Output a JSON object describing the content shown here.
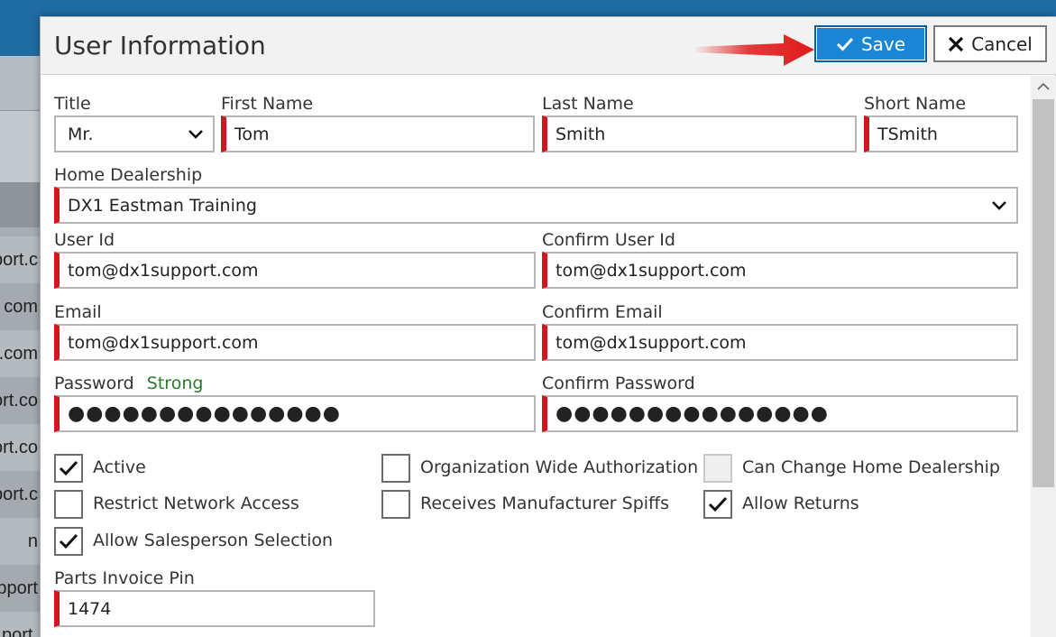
{
  "background": {
    "rows": [
      "port.c",
      "com",
      "rt.com",
      "ort.co",
      "ort.co",
      "port.c",
      "n",
      "pport",
      "port."
    ]
  },
  "dialog": {
    "title": "User Information",
    "save_label": "Save",
    "cancel_label": "Cancel"
  },
  "form": {
    "title_label": "Title",
    "title_value": "Mr.",
    "first_name_label": "First Name",
    "first_name_value": "Tom",
    "last_name_label": "Last Name",
    "last_name_value": "Smith",
    "short_name_label": "Short Name",
    "short_name_value": "TSmith",
    "home_dealership_label": "Home Dealership",
    "home_dealership_value": "DX1 Eastman Training",
    "user_id_label": "User Id",
    "user_id_value": "tom@dx1support.com",
    "confirm_user_id_label": "Confirm User Id",
    "confirm_user_id_value": "tom@dx1support.com",
    "email_label": "Email",
    "email_value": "tom@dx1support.com",
    "confirm_email_label": "Confirm Email",
    "confirm_email_value": "tom@dx1support.com",
    "password_label": "Password",
    "password_strength": "Strong",
    "password_value": "●●●●●●●●●●●●●●●",
    "confirm_password_label": "Confirm Password",
    "confirm_password_value": "●●●●●●●●●●●●●●●",
    "parts_invoice_pin_label": "Parts Invoice Pin",
    "parts_invoice_pin_value": "1474"
  },
  "checkboxes": [
    {
      "label": "Active",
      "checked": true
    },
    {
      "label": "Organization Wide Authorization",
      "checked": false
    },
    {
      "label": "Can Change Home Dealership",
      "checked": false,
      "disabled": true
    },
    {
      "label": "Restrict Network Access",
      "checked": false
    },
    {
      "label": "Receives Manufacturer Spiffs",
      "checked": false
    },
    {
      "label": "Allow Returns",
      "checked": true
    },
    {
      "label": "Allow Salesperson Selection",
      "checked": true
    }
  ],
  "colors": {
    "accent": "#1b86d6",
    "required_marker": "#d0161e",
    "strength_good": "#2c7a2c",
    "annotation_arrow": "#e01a1a"
  },
  "icons": {
    "save": "checkmark-icon",
    "cancel": "x-icon",
    "dropdown": "chevron-down-icon",
    "scroll_up": "chevron-up-icon",
    "annotation": "red-arrow-icon"
  }
}
